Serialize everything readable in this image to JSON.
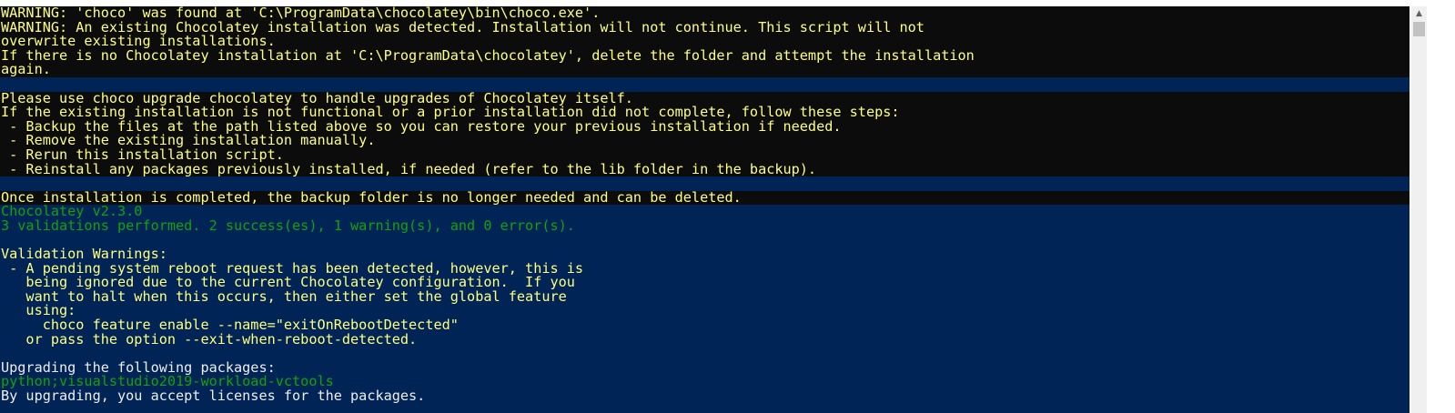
{
  "console": {
    "lines": [
      {
        "text": "WARNING: 'choco' was found at 'C:\\ProgramData\\chocolatey\\bin\\choco.exe'.",
        "style": "warn"
      },
      {
        "text": "WARNING: An existing Chocolatey installation was detected. Installation will not continue. This script will not",
        "style": "warn"
      },
      {
        "text": "overwrite existing installations.",
        "style": "warn"
      },
      {
        "text": "If there is no Chocolatey installation at 'C:\\ProgramData\\chocolatey', delete the folder and attempt the installation",
        "style": "warn"
      },
      {
        "text": "again.",
        "style": "warn"
      },
      {
        "text": "",
        "style": "blank"
      },
      {
        "text": "Please use choco upgrade chocolatey to handle upgrades of Chocolatey itself.",
        "style": "warn"
      },
      {
        "text": "If the existing installation is not functional or a prior installation did not complete, follow these steps:",
        "style": "warn"
      },
      {
        "text": " - Backup the files at the path listed above so you can restore your previous installation if needed.",
        "style": "warn"
      },
      {
        "text": " - Remove the existing installation manually.",
        "style": "warn"
      },
      {
        "text": " - Rerun this installation script.",
        "style": "warn"
      },
      {
        "text": " - Reinstall any packages previously installed, if needed (refer to the lib folder in the backup).",
        "style": "warn"
      },
      {
        "text": "",
        "style": "blank"
      },
      {
        "text": "Once installation is completed, the backup folder is no longer needed and can be deleted.",
        "style": "warn"
      },
      {
        "text": "Chocolatey v2.3.0",
        "style": "green"
      },
      {
        "text": "3 validations performed. 2 success(es), 1 warning(s), and 0 error(s).",
        "style": "green"
      },
      {
        "text": "",
        "style": "blank"
      },
      {
        "text": "Validation Warnings:",
        "style": "yellow"
      },
      {
        "text": " - A pending system reboot request has been detected, however, this is",
        "style": "yellow"
      },
      {
        "text": "   being ignored due to the current Chocolatey configuration.  If you",
        "style": "yellow"
      },
      {
        "text": "   want to halt when this occurs, then either set the global feature",
        "style": "yellow"
      },
      {
        "text": "   using:",
        "style": "yellow"
      },
      {
        "text": "     choco feature enable --name=\"exitOnRebootDetected\"",
        "style": "yellow"
      },
      {
        "text": "   or pass the option --exit-when-reboot-detected.",
        "style": "yellow"
      },
      {
        "text": "",
        "style": "blank"
      },
      {
        "text": "Upgrading the following packages:",
        "style": "white"
      },
      {
        "text": "python;visualstudio2019-workload-vctools",
        "style": "green"
      },
      {
        "text": "By upgrading, you accept licenses for the packages.",
        "style": "white"
      }
    ]
  },
  "colors": {
    "console_bg": "#012456",
    "warning_bg": "#0c0c0c",
    "warning_fg": "#ffff80",
    "success_fg": "#13a10e",
    "default_fg": "#eeedf0"
  },
  "scrollbar": {
    "up_arrow_icon": "chevron-up-icon"
  }
}
